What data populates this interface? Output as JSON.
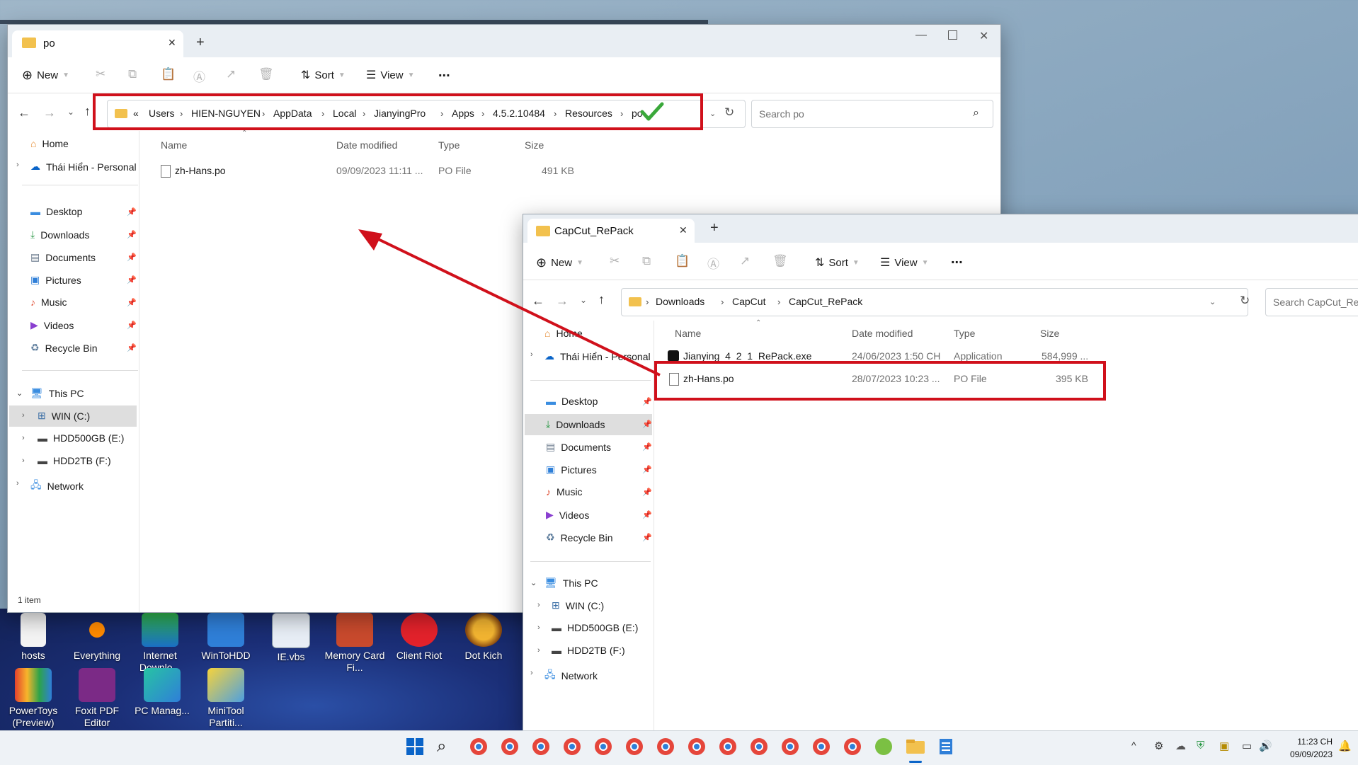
{
  "desktop": {
    "icons": [
      {
        "label": "hosts"
      },
      {
        "label": "Everything"
      },
      {
        "label": "Internet Downlo..."
      },
      {
        "label": "WinToHDD"
      },
      {
        "label": "IE.vbs"
      },
      {
        "label": "Memory Card Fi..."
      },
      {
        "label": "Client Riot"
      },
      {
        "label": "Dot Kich"
      },
      {
        "label": "PowerToys (Preview)"
      },
      {
        "label": "Foxit PDF Editor"
      },
      {
        "label": "PC Manag..."
      },
      {
        "label": "MiniTool Partiti..."
      }
    ]
  },
  "window1": {
    "tab_title": "po",
    "new_tab": "+",
    "toolbar": {
      "new": "New",
      "sort": "Sort",
      "view": "View",
      "more": "..."
    },
    "breadcrumb": {
      "overflow": "«",
      "items": [
        "Users",
        "HIEN-NGUYEN",
        "AppData",
        "Local",
        "JianyingPro",
        "Apps",
        "4.5.2.10484",
        "Resources",
        "po"
      ]
    },
    "search_placeholder": "Search po",
    "nav": {
      "home": "Home",
      "onedrive": "Thái Hiển - Personal",
      "quick": [
        "Desktop",
        "Downloads",
        "Documents",
        "Pictures",
        "Music",
        "Videos",
        "Recycle Bin"
      ],
      "this_pc": "This PC",
      "drives": [
        "WIN (C:)",
        "HDD500GB (E:)",
        "HDD2TB (F:)"
      ],
      "network": "Network"
    },
    "columns": {
      "name": "Name",
      "date": "Date modified",
      "type": "Type",
      "size": "Size"
    },
    "files": [
      {
        "name": "zh-Hans.po",
        "date": "09/09/2023 11:11 ...",
        "type": "PO File",
        "size": "491 KB"
      }
    ],
    "status": "1 item"
  },
  "window2": {
    "tab_title": "CapCut_RePack",
    "new_tab": "+",
    "toolbar": {
      "new": "New",
      "sort": "Sort",
      "view": "View",
      "more": "..."
    },
    "breadcrumb": {
      "items": [
        "Downloads",
        "CapCut",
        "CapCut_RePack"
      ]
    },
    "search_placeholder": "Search CapCut_RePa",
    "nav": {
      "home": "Home",
      "onedrive": "Thái Hiển - Personal",
      "quick": [
        "Desktop",
        "Downloads",
        "Documents",
        "Pictures",
        "Music",
        "Videos",
        "Recycle Bin"
      ],
      "this_pc": "This PC",
      "drives": [
        "WIN (C:)",
        "HDD500GB (E:)",
        "HDD2TB (F:)"
      ],
      "network": "Network"
    },
    "columns": {
      "name": "Name",
      "date": "Date modified",
      "type": "Type",
      "size": "Size"
    },
    "files": [
      {
        "name": "Jianying_4_2_1_RePack.exe",
        "date": "24/06/2023 1:50 CH",
        "type": "Application",
        "size": "584,999 ..."
      },
      {
        "name": "zh-Hans.po",
        "date": "28/07/2023 10:23 ...",
        "type": "PO File",
        "size": "395 KB"
      }
    ]
  },
  "taskbar": {
    "time": "11:23 CH",
    "date": "09/09/2023"
  },
  "colors": {
    "annotation": "#d0101b",
    "check": "#3aa83a",
    "accent": "#0a64c8"
  }
}
